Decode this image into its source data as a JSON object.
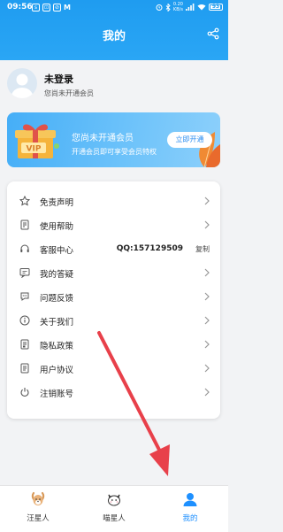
{
  "status_bar": {
    "time": "09:56",
    "icons": [
      "s",
      "⊡",
      "⊘",
      "M"
    ],
    "speed": "0.20\nKB/s",
    "battery": "93",
    "battery_level": 0.93
  },
  "header": {
    "title": "我的",
    "share_icon": "share-icon"
  },
  "user": {
    "name": "未登录",
    "subtitle": "您尚未开通会员"
  },
  "vip": {
    "badge": "VIP",
    "title": "您尚未开通会员",
    "subtitle": "开通会员即可享受会员特权",
    "button": "立即开通"
  },
  "menu": [
    {
      "label": "免责声明",
      "icon": "star-icon"
    },
    {
      "label": "使用帮助",
      "icon": "document-icon"
    },
    {
      "label": "客服中心",
      "icon": "headset-icon",
      "extra": "QQ:157129509",
      "action": "复制"
    },
    {
      "label": "我的答疑",
      "icon": "chat-icon"
    },
    {
      "label": "问题反馈",
      "icon": "feedback-icon"
    },
    {
      "label": "关于我们",
      "icon": "info-icon"
    },
    {
      "label": "隐私政策",
      "icon": "privacy-icon"
    },
    {
      "label": "用户协议",
      "icon": "agreement-icon"
    },
    {
      "label": "注销账号",
      "icon": "power-icon"
    }
  ],
  "bottom_nav": [
    {
      "label": "汪星人",
      "icon": "dog-icon",
      "active": false
    },
    {
      "label": "喵星人",
      "icon": "cat-icon",
      "active": false
    },
    {
      "label": "我的",
      "icon": "user-icon",
      "active": true
    }
  ],
  "colors": {
    "primary": "#1f9cf0",
    "annotation_arrow": "#e8404a"
  }
}
